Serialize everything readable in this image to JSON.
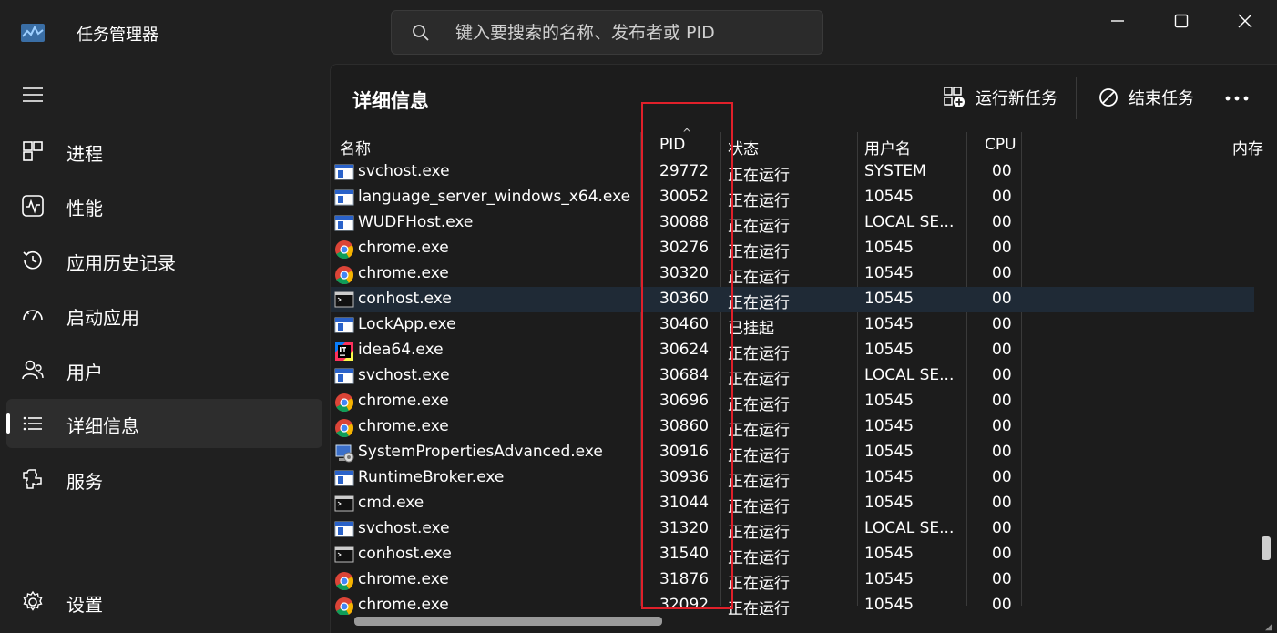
{
  "window": {
    "title": "任务管理器",
    "search_placeholder": "键入要搜索的名称、发布者或 PID"
  },
  "sidebar": {
    "items": [
      {
        "label": "进程",
        "icon": "processes-icon"
      },
      {
        "label": "性能",
        "icon": "performance-icon"
      },
      {
        "label": "应用历史记录",
        "icon": "app-history-icon"
      },
      {
        "label": "启动应用",
        "icon": "startup-apps-icon"
      },
      {
        "label": "用户",
        "icon": "users-icon"
      },
      {
        "label": "详细信息",
        "icon": "details-icon",
        "active": true
      },
      {
        "label": "服务",
        "icon": "services-icon"
      }
    ],
    "settings_label": "设置"
  },
  "main": {
    "title": "详细信息",
    "run_new_task": "运行新任务",
    "end_task": "结束任务"
  },
  "table": {
    "headers": {
      "name": "名称",
      "pid": "PID",
      "status": "状态",
      "user": "用户名",
      "cpu": "CPU",
      "memory": "内存"
    },
    "rows": [
      {
        "icon": "service-window-icon",
        "name": "svchost.exe",
        "pid": "29772",
        "status": "正在运行",
        "user": "SYSTEM",
        "cpu": "00"
      },
      {
        "icon": "service-window-icon",
        "name": "language_server_windows_x64.exe",
        "pid": "30052",
        "status": "正在运行",
        "user": "10545",
        "cpu": "00"
      },
      {
        "icon": "service-window-icon",
        "name": "WUDFHost.exe",
        "pid": "30088",
        "status": "正在运行",
        "user": "LOCAL SE...",
        "cpu": "00"
      },
      {
        "icon": "chrome-icon",
        "name": "chrome.exe",
        "pid": "30276",
        "status": "正在运行",
        "user": "10545",
        "cpu": "00"
      },
      {
        "icon": "chrome-icon",
        "name": "chrome.exe",
        "pid": "30320",
        "status": "正在运行",
        "user": "10545",
        "cpu": "00"
      },
      {
        "icon": "console-icon",
        "name": "conhost.exe",
        "pid": "30360",
        "status": "正在运行",
        "user": "10545",
        "cpu": "00",
        "selected": true
      },
      {
        "icon": "service-window-icon",
        "name": "LockApp.exe",
        "pid": "30460",
        "status": "已挂起",
        "user": "10545",
        "cpu": "00"
      },
      {
        "icon": "intellij-icon",
        "name": "idea64.exe",
        "pid": "30624",
        "status": "正在运行",
        "user": "10545",
        "cpu": "00"
      },
      {
        "icon": "service-window-icon",
        "name": "svchost.exe",
        "pid": "30684",
        "status": "正在运行",
        "user": "LOCAL SE...",
        "cpu": "00"
      },
      {
        "icon": "chrome-icon",
        "name": "chrome.exe",
        "pid": "30696",
        "status": "正在运行",
        "user": "10545",
        "cpu": "00"
      },
      {
        "icon": "chrome-icon",
        "name": "chrome.exe",
        "pid": "30860",
        "status": "正在运行",
        "user": "10545",
        "cpu": "00"
      },
      {
        "icon": "system-properties-icon",
        "name": "SystemPropertiesAdvanced.exe",
        "pid": "30916",
        "status": "正在运行",
        "user": "10545",
        "cpu": "00"
      },
      {
        "icon": "service-window-icon",
        "name": "RuntimeBroker.exe",
        "pid": "30936",
        "status": "正在运行",
        "user": "10545",
        "cpu": "00"
      },
      {
        "icon": "console-icon",
        "name": "cmd.exe",
        "pid": "31044",
        "status": "正在运行",
        "user": "10545",
        "cpu": "00"
      },
      {
        "icon": "service-window-icon",
        "name": "svchost.exe",
        "pid": "31320",
        "status": "正在运行",
        "user": "LOCAL SE...",
        "cpu": "00"
      },
      {
        "icon": "console-icon",
        "name": "conhost.exe",
        "pid": "31540",
        "status": "正在运行",
        "user": "10545",
        "cpu": "00"
      },
      {
        "icon": "chrome-icon",
        "name": "chrome.exe",
        "pid": "31876",
        "status": "正在运行",
        "user": "10545",
        "cpu": "00"
      },
      {
        "icon": "chrome-icon",
        "name": "chrome.exe",
        "pid": "32092",
        "status": "正在运行",
        "user": "10545",
        "cpu": "00"
      }
    ]
  },
  "colors": {
    "highlight": "#e0202a",
    "selected_row": "#1f2a36"
  }
}
